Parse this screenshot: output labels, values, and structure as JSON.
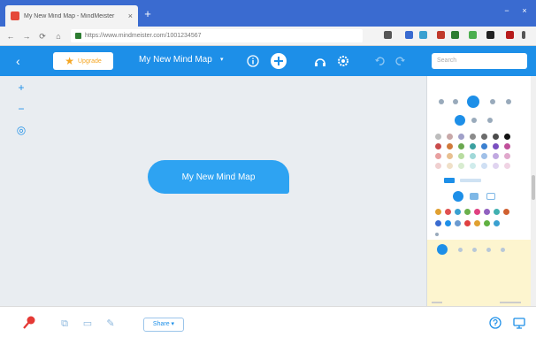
{
  "browser": {
    "tab_title": "My New Mind Map - MindMeister",
    "tab_close": "×",
    "newtab": "+",
    "url": "https://www.mindmeister.com/1001234567",
    "win_min": "−",
    "win_close": "×"
  },
  "toolbar": {
    "back": "‹",
    "upgrade_label": "Upgrade",
    "map_title": "My New Mind Map",
    "title_caret": "▾",
    "search_placeholder": "Search"
  },
  "zoom": {
    "in": "+",
    "out": "−",
    "center": "◎"
  },
  "map": {
    "root_node": "My New Mind Map"
  },
  "bottombar": {
    "share_label": "Share ▾"
  },
  "panel": {
    "tab_active_color": "#1d8fe8",
    "palette_rows": [
      [
        "#bdbdbd",
        "#c8a8a8",
        "#a0a0c8",
        "#8b8b8b",
        "#6b6b6b",
        "#4b4b4b",
        "#111111"
      ],
      [
        "#c94b4b",
        "#d07a3a",
        "#6aa84f",
        "#3aa0a0",
        "#3a7fd0",
        "#7a4fc0",
        "#c04f9a"
      ],
      [
        "#e8a0a0",
        "#e8c090",
        "#b8dca0",
        "#a0d8d8",
        "#a0c0e8",
        "#c0a8e0",
        "#e0a8cc"
      ],
      [
        "#f0d0d0",
        "#f0e0c8",
        "#d8ecd0",
        "#d0ecec",
        "#d0e0f4",
        "#e0d4f0",
        "#f0d4e4"
      ]
    ],
    "icon_row": [
      "#e0a030",
      "#e05050",
      "#3aa0d0",
      "#6ab04c",
      "#e04080",
      "#9060c0",
      "#40b0b0",
      "#d06030"
    ],
    "icon_row2": [
      "#3a6bd0",
      "#1d8fe8",
      "#6a9ad0",
      "#e04040",
      "#e0a030",
      "#60b040",
      "#3aa0d0"
    ]
  }
}
